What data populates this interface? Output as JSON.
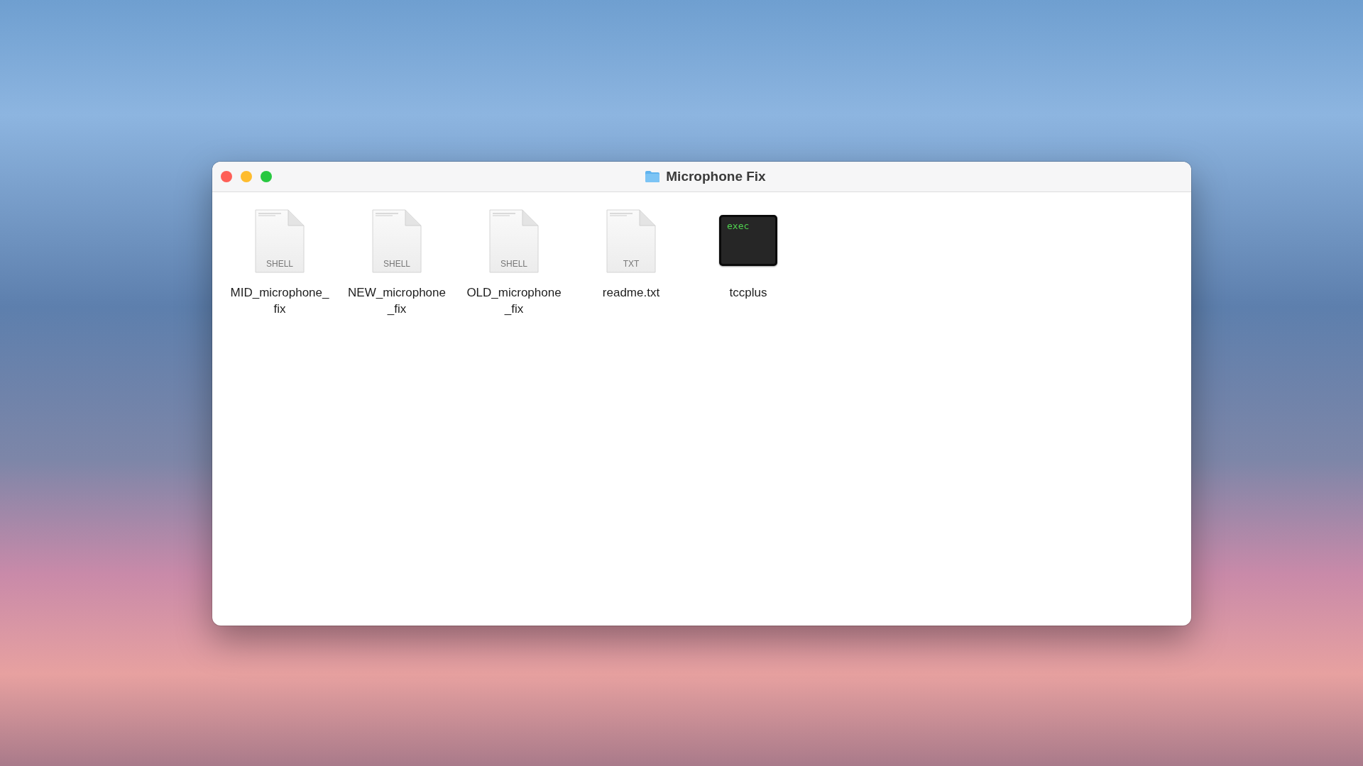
{
  "window": {
    "title": "Microphone Fix"
  },
  "files": [
    {
      "name": "MID_microphone_fix",
      "kind": "document",
      "badge": "SHELL"
    },
    {
      "name": "NEW_microphone_fix",
      "kind": "document",
      "badge": "SHELL"
    },
    {
      "name": "OLD_microphone_fix",
      "kind": "document",
      "badge": "SHELL"
    },
    {
      "name": "readme.txt",
      "kind": "document",
      "badge": "TXT"
    },
    {
      "name": "tccplus",
      "kind": "executable",
      "badge": "exec"
    }
  ]
}
